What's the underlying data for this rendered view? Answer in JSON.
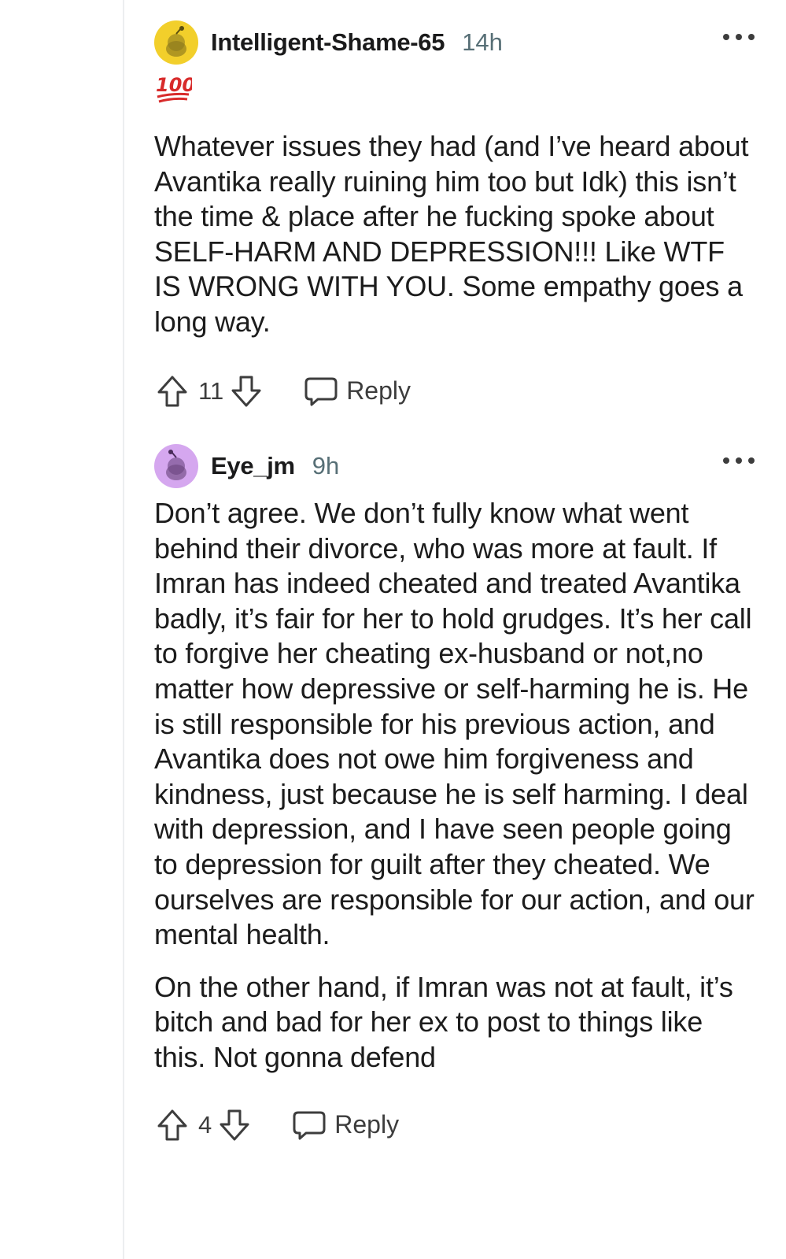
{
  "comments": [
    {
      "username": "Intelligent-Shame-65",
      "time": "14h",
      "flair_icon": "hundred-points-emoji",
      "avatar_color": "#f2cf2b",
      "body": "Whatever issues they had (and I’ve heard about Avantika really ruining him too but Idk) this isn’t the time & place after he fucking spoke about SELF-HARM AND DEPRESSION!!! Like WTF IS WRONG WITH YOU. Some empathy goes a long way.",
      "votes": "11",
      "reply_label": "Reply"
    },
    {
      "username": "Eye_jm",
      "time": "9h",
      "avatar_color": "#d5a7ef",
      "paragraphs": [
        "Don’t agree. We don’t fully know what went behind their divorce, who was more at fault. If Imran has indeed cheated and treated Avantika badly, it’s fair for her to hold grudges. It’s her call to forgive her cheating ex-husband or not,no matter how depressive or self-harming he is. He is still responsible for his previous action, and Avantika does not owe him forgiveness and kindness, just because he is self harming. I deal with depression, and I have seen people going to depression for guilt after they cheated. We ourselves are responsible for our action, and our mental health.",
        "On the other hand, if Imran was not at fault, it’s bitch and bad for her ex to post to things like this. Not gonna defend"
      ],
      "votes": "4",
      "reply_label": "Reply"
    }
  ],
  "icons": {
    "upvote": "upvote-arrow-icon",
    "downvote": "downvote-arrow-icon",
    "reply": "speech-bubble-icon",
    "more": "more-options-icon"
  }
}
